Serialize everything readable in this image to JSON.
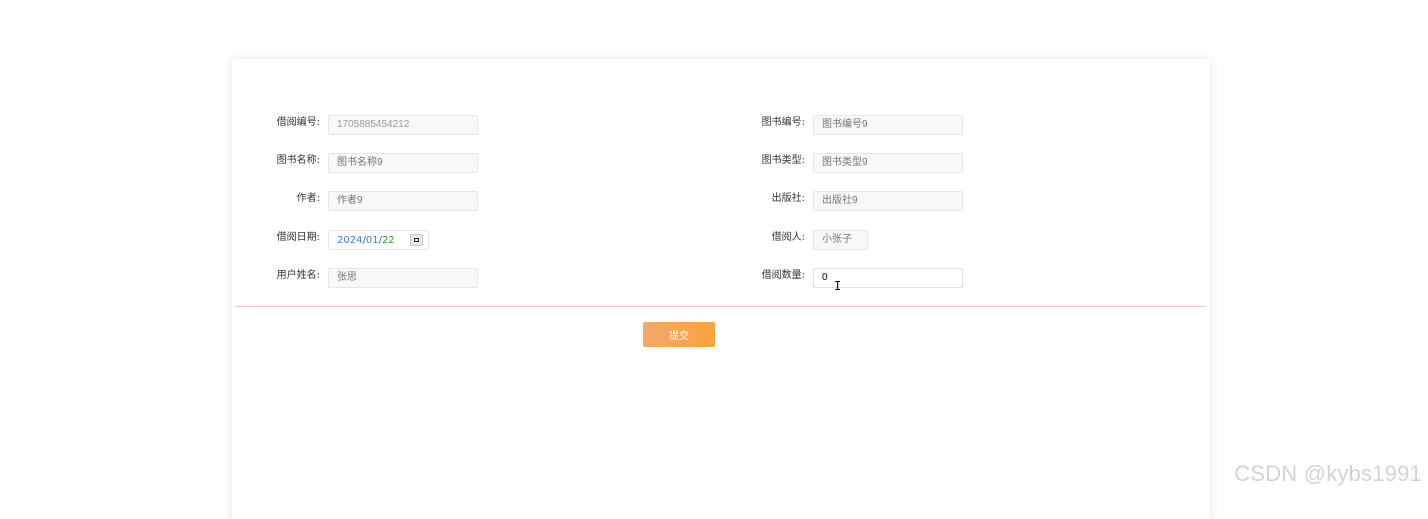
{
  "form": {
    "left": [
      {
        "label": "借阅编号:",
        "value": "1705885454212",
        "placeholder": ""
      },
      {
        "label": "图书名称:",
        "value": "",
        "placeholder": "图书名称9"
      },
      {
        "label": "作者:",
        "value": "",
        "placeholder": "作者9"
      },
      {
        "label": "借阅日期:",
        "date": {
          "year": "2024",
          "month": "01",
          "day": "22"
        }
      },
      {
        "label": "用户姓名:",
        "value": "",
        "placeholder": "张思"
      }
    ],
    "right": [
      {
        "label": "图书编号:",
        "value": "",
        "placeholder": "图书编号9"
      },
      {
        "label": "图书类型:",
        "value": "",
        "placeholder": "图书类型9"
      },
      {
        "label": "出版社:",
        "value": "",
        "placeholder": "出版社9"
      },
      {
        "label": "借阅人:",
        "value": "",
        "placeholder": "小张子"
      },
      {
        "label": "借阅数量:",
        "value": "0",
        "placeholder": ""
      }
    ],
    "submit_label": "提交"
  },
  "watermark": "CSDN @kybs1991"
}
